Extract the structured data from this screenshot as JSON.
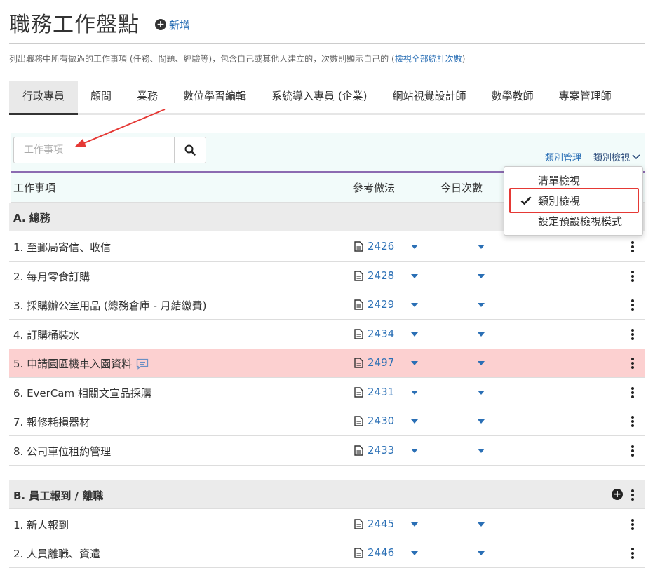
{
  "header": {
    "title": "職務工作盤點",
    "add_label": "新增",
    "description": "列出職務中所有做過的工作事項 (任務、問題、經驗等)，包含自己或其他人建立的，次數則顯示自己的 (",
    "description_link": "檢視全部統計次數",
    "description_end": ")"
  },
  "tabs": [
    "行政專員",
    "顧問",
    "業務",
    "數位學習編輯",
    "系統導入專員 (企業)",
    "網站視覺設計師",
    "數學教師",
    "專案管理師"
  ],
  "search": {
    "placeholder": "工作事項"
  },
  "toolbar": {
    "category_manage": "類別管理",
    "category_view": "類別檢視"
  },
  "table": {
    "columns": {
      "item": "工作事項",
      "reference": "參考做法",
      "today": "今日次數"
    }
  },
  "groups": [
    {
      "label": "A. 總務",
      "rows": [
        {
          "name": "1. 至郵局寄信、收信",
          "ref": "2426"
        },
        {
          "name": "2. 每月零食訂購",
          "ref": "2428"
        },
        {
          "name": "3. 採購辦公室用品 (總務倉庫 - 月結繳費)",
          "ref": "2429"
        },
        {
          "name": "4. 訂購桶裝水",
          "ref": "2434"
        },
        {
          "name": "5. 申請園區機車入園資料",
          "ref": "2497"
        },
        {
          "name": "6. EverCam 相關文宣品採購",
          "ref": "2431"
        },
        {
          "name": "7. 報修耗損器材",
          "ref": "2430"
        },
        {
          "name": "8. 公司車位租約管理",
          "ref": "2433"
        }
      ]
    },
    {
      "label": "B. 員工報到 / 離職",
      "rows": [
        {
          "name": "1. 新人報到",
          "ref": "2445"
        },
        {
          "name": "2. 人員離職、資遣",
          "ref": "2446"
        }
      ]
    }
  ],
  "dropdown": {
    "items": [
      "清單檢視",
      "類別檢視",
      "設定預設檢視模式"
    ],
    "selected": "類別檢視"
  },
  "colors": {
    "link": "#2a6fb5",
    "highlight_row": "#fcd0d0",
    "accent_rule": "#8c6bb1",
    "annotation_red": "#e53935"
  }
}
